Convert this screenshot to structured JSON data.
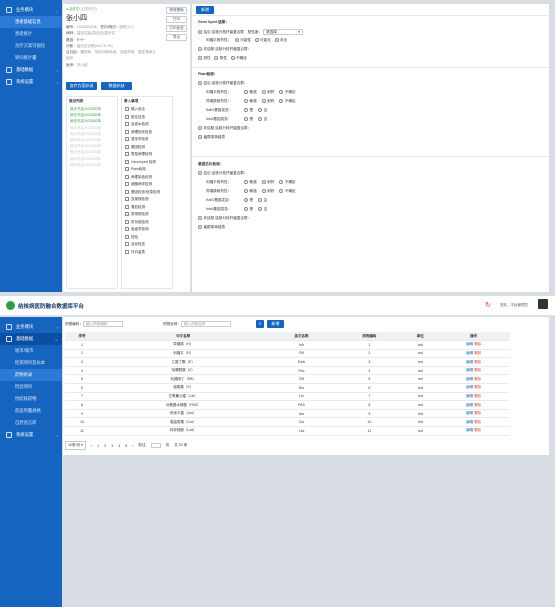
{
  "top_sidebar": [
    {
      "label": "业务模块",
      "expanded": true
    },
    {
      "label": "患者基础信息",
      "active": true
    },
    {
      "label": "患者统计"
    },
    {
      "label": "治疗方案可视化"
    },
    {
      "label": "转归统计量"
    },
    {
      "label": "基础数据",
      "expanded": false
    },
    {
      "label": "系统设置",
      "expanded": false
    }
  ],
  "patient": {
    "status": "● 治疗中",
    "tag": "(已初诊已)",
    "name": "张小四",
    "id_label": "编号：",
    "id_value": "1520820246",
    "org_label": "签约/随访：",
    "org_value": "医院小六",
    "type_label": "病种：",
    "type_value": "高血压症(高血压)复诊住",
    "gene_label": "基因：",
    "gene_value": "R*H*",
    "diag_label": "诊断：",
    "diag_value": "高血压诊断(NCCN Th)",
    "note_label": "合并症：",
    "note_value": "糖尿病、冠状动脉疾病、血脂异常、慢性肾病无症状",
    "doc_label": "医师：",
    "doc_value": "刘小组"
  },
  "action_buttons": [
    "修改基础",
    "打印",
    "打印检查",
    "导出"
  ],
  "main_buttons": {
    "add_record": "治疗方案补录",
    "update_record": "数据补缺"
  },
  "visit_list": {
    "title": "就诊列表",
    "items": [
      "就诊开启2023052年",
      "就诊开启2023052年",
      "就诊开启2023052年",
      "就诊开启2023052年",
      "就诊开启2023052年",
      "就诊开启2023052年",
      "就诊开启2023052年",
      "就诊开启2023052年",
      "就诊开启2023052年",
      "就诊开启2023052年"
    ]
  },
  "entry_list": {
    "title": "录入事项",
    "items": [
      "输入用法",
      "既往检查",
      "血液水检测",
      "病理相关检查",
      "遗传学检查",
      "基因检测",
      "表型病理检测",
      "GenoXpert 检测",
      "Plain检测",
      "病理染色检测",
      "细胞病学检测",
      "基因检查/信息检测",
      "血常规检测",
      "凝血检测",
      "尿常规检测",
      "肝功能检测",
      "免疫学检测",
      "检验",
      "血化检查",
      "评价量表"
    ]
  },
  "form_top_btn": "新增",
  "section1": {
    "title": "Gene Xpert 结果：",
    "q1": "结论 结核分枝杆菌复合群",
    "q1_sel_label": "阳性度：",
    "q1_sel": "请选择",
    "q2": "利福平耐药性：",
    "q2_opts": [
      "可能性",
      "可能无",
      "未出"
    ],
    "q3": "非结核 结核分枝杆菌复合群：",
    "q4_opts": [
      "阳性",
      "阴性",
      "不确定"
    ]
  },
  "section2": {
    "title": "Plain检测：",
    "q1": "结论 结核分枝杆菌复合群：",
    "rows": [
      {
        "label": "利福平耐药性：",
        "opts": [
          "敏感",
          "耐药",
          "不确定"
        ]
      },
      {
        "label": "异烟肼耐药性：",
        "opts": [
          "敏感",
          "耐药",
          "不确定"
        ]
      },
      {
        "label": "KatG基因突变：",
        "opts": [
          "是",
          "否"
        ]
      },
      {
        "label": "InhA基因突变：",
        "opts": [
          "是",
          "否"
        ]
      }
    ],
    "q2": "非结核 结核分枝杆菌复合群：",
    "q3": "菌群类单链表"
  },
  "section3": {
    "title": "基因芯片检测：",
    "q1": "结论 结核分枝杆菌复合群：",
    "rows": [
      {
        "label": "利福平耐药性：",
        "opts": [
          "敏感",
          "耐药",
          "不确定"
        ]
      },
      {
        "label": "异烟肼耐药性：",
        "opts": [
          "敏感",
          "耐药",
          "不确定"
        ]
      },
      {
        "label": "KatG基因突变：",
        "opts": [
          "是",
          "否"
        ]
      },
      {
        "label": "InhA基因突变：",
        "opts": [
          "是",
          "否"
        ]
      }
    ],
    "q2": "非结核 结核分枝杆菌复合群：",
    "q3": "菌群类单链表"
  },
  "header": {
    "title": "结核病医防融合数据库平台",
    "user": "您好，平台管理员",
    "help": "客服"
  },
  "bottom_sidebar": [
    {
      "label": "业务模块",
      "type": "group"
    },
    {
      "label": "基础数据",
      "type": "group-open"
    },
    {
      "label": "地市/城市",
      "type": "sub"
    },
    {
      "label": "检测项目及标本",
      "type": "sub"
    },
    {
      "label": "药物目录",
      "type": "sub",
      "selected": true
    },
    {
      "label": "检验项目",
      "type": "sub"
    },
    {
      "label": "抗结核药物",
      "type": "sub"
    },
    {
      "label": "药品剂量规格",
      "type": "sub"
    },
    {
      "label": "自然语言库",
      "type": "sub"
    },
    {
      "label": "系统设置",
      "type": "group"
    }
  ],
  "filter": {
    "code_label": "药物编码：",
    "code_ph": "输入药物编码",
    "name_label": "药物名称：",
    "name_ph": "输入药物名称",
    "search": "搜索",
    "add": "新增"
  },
  "table": {
    "headers": [
      "序号",
      "中文名称",
      "英文名称",
      "药物编码",
      "单位",
      "操作"
    ],
    "rows": [
      [
        "1",
        "异烟肼（H）",
        "Inh",
        "1",
        "md"
      ],
      [
        "2",
        "利福平（R）",
        "Rif",
        "2",
        "md"
      ],
      [
        "3",
        "乙胺丁醇（E）",
        "Emb",
        "3",
        "md"
      ],
      [
        "4",
        "吡嗪酰胺（Z）",
        "Pza",
        "4",
        "md"
      ],
      [
        "5",
        "利福喷丁（Rft）",
        "Rft",
        "5",
        "md"
      ],
      [
        "6",
        "链霉素（S）",
        "Sm",
        "6",
        "md"
      ],
      [
        "7",
        "左氧氟沙星（Lfx）",
        "Lfx",
        "7",
        "md"
      ],
      [
        "8",
        "对氨基水杨酸（PAS）",
        "PAS",
        "8",
        "md"
      ],
      [
        "9",
        "阿米卡星（Am）",
        "Am",
        "9",
        "md"
      ],
      [
        "10",
        "卷曲霉素（Cm）",
        "Cm",
        "10",
        "md"
      ],
      [
        "11",
        "利奈唑胺（Lzd）",
        "Lzd",
        "11",
        "md"
      ]
    ],
    "edit": "编辑",
    "delete": "删除"
  },
  "pager": {
    "size": "10条/页",
    "pages": [
      "1",
      "2",
      "3",
      "4",
      "5"
    ],
    "goto": "前往",
    "page": "页",
    "total": "共 20 条"
  }
}
